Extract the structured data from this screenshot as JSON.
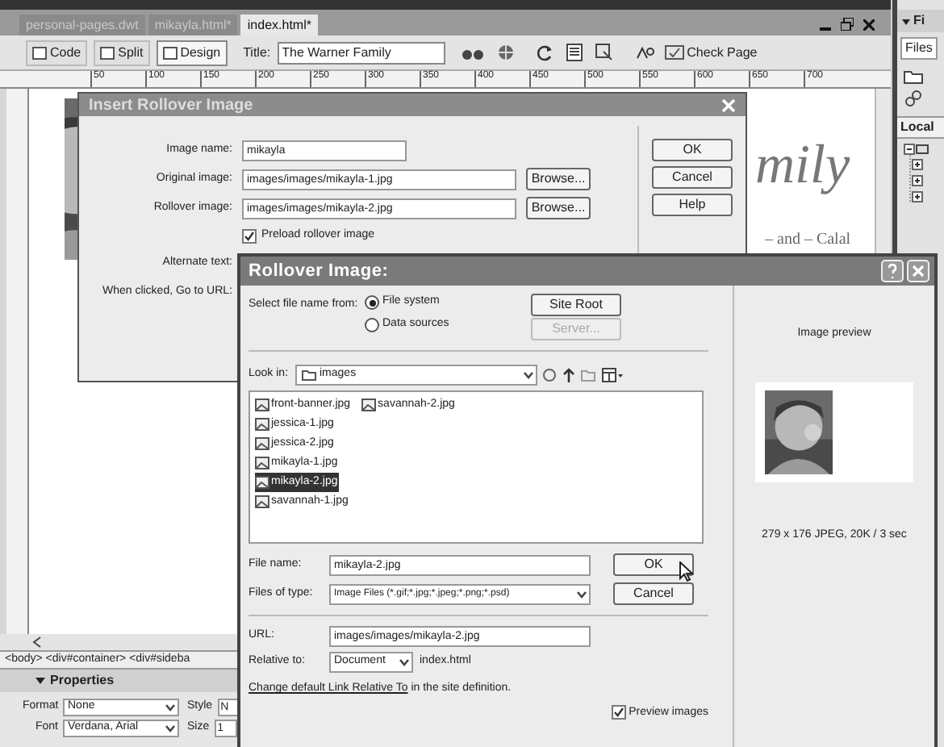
{
  "document_tabs": [
    {
      "label": "personal-pages.dwt",
      "selected": false
    },
    {
      "label": "mikayla.html*",
      "selected": false
    },
    {
      "label": "index.html*",
      "selected": true
    }
  ],
  "toolbar": {
    "view_buttons": [
      {
        "label": "Code",
        "selected": false
      },
      {
        "label": "Split",
        "selected": false
      },
      {
        "label": "Design",
        "selected": true
      }
    ],
    "title_label": "Title:",
    "title_value": "The Warner Family",
    "check_page": "Check Page"
  },
  "ruler_ticks": [
    "50",
    "100",
    "150",
    "200",
    "250",
    "300",
    "350",
    "400",
    "450",
    "500",
    "550",
    "600",
    "650",
    "700"
  ],
  "design_view": {
    "heading_fragment": "mily",
    "subtitle_fragment": "– and – Calal"
  },
  "insert_dialog": {
    "title": "Insert Rollover Image",
    "fields": [
      {
        "kind": "text",
        "label": "Image name:",
        "value": "mikayla"
      },
      {
        "kind": "browse",
        "label": "Original image:",
        "value": "images/images/mikayla-1.jpg",
        "button": "Browse..."
      },
      {
        "kind": "browse",
        "label": "Rollover image:",
        "value": "images/images/mikayla-2.jpg",
        "button": "Browse..."
      },
      {
        "kind": "checkbox",
        "label": "Preload rollover image",
        "checked": true
      },
      {
        "kind": "label",
        "label": "Alternate text:"
      },
      {
        "kind": "label",
        "label": "When clicked, Go to URL:"
      }
    ],
    "buttons": [
      "OK",
      "Cancel",
      "Help"
    ]
  },
  "rollover_dialog": {
    "title": "Rollover Image:",
    "select_label": "Select file name from:",
    "sources": [
      {
        "label": "File system",
        "selected": true
      },
      {
        "label": "Data sources",
        "selected": false
      }
    ],
    "site_root": "Site Root",
    "server": {
      "label": "Server...",
      "disabled": true
    },
    "look_in_label": "Look in:",
    "look_in_value": "images",
    "files": [
      {
        "name": "front-banner.jpg",
        "selected": false
      },
      {
        "name": "jessica-1.jpg",
        "selected": false
      },
      {
        "name": "jessica-2.jpg",
        "selected": false
      },
      {
        "name": "mikayla-1.jpg",
        "selected": false
      },
      {
        "name": "mikayla-2.jpg",
        "selected": true
      },
      {
        "name": "savannah-1.jpg",
        "selected": false
      },
      {
        "name": "savannah-2.jpg",
        "selected": false
      }
    ],
    "file_name_label": "File name:",
    "file_name_value": "mikayla-2.jpg",
    "ok": "OK",
    "type_label": "Files of type:",
    "type_value": "Image Files (*.gif;*.jpg;*.jpeg;*.png;*.psd)",
    "cancel": "Cancel",
    "url_label": "URL:",
    "url_value": "images/images/mikayla-2.jpg",
    "relative_label": "Relative to:",
    "relative_value": "Document",
    "relative_file": "index.html",
    "link": "Change default Link Relative To",
    "link_rest": "in the site definition.",
    "preview_images": {
      "label": "Preview images",
      "checked": true
    },
    "preview_title": "Image preview",
    "preview_info": "279 x 176 JPEG, 20K / 3 sec"
  },
  "tag_selector": "<body> <div#container> <div#sideba",
  "properties": {
    "title": "Properties",
    "expanded": true,
    "format_label": "Format",
    "format_value": "None",
    "style_label": "Style",
    "style_value": "N",
    "font_label": "Font",
    "font_value": "Verdana, Arial",
    "size_label": "Size",
    "size_value": "1"
  },
  "files_panel": {
    "title": "Fi",
    "expanded": true,
    "tab": "Files",
    "local_label": "Local"
  }
}
